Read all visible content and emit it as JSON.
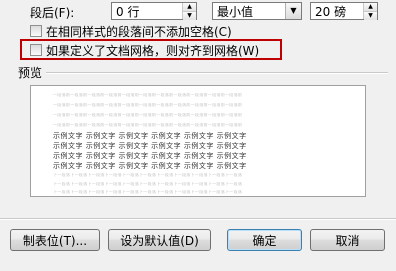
{
  "spacing": {
    "after_label": "段后(F):",
    "after_value": "0 行",
    "line_rule": "最小值",
    "line_at": "20 磅"
  },
  "options": {
    "no_space_same_style": "在相同样式的段落间不添加空格(C)",
    "snap_to_grid": "如果定义了文档网格，则对齐到网格(W)"
  },
  "preview": {
    "label": "预览",
    "prev_text": "一段落前一段落前一段落前一段落前一段落前一段落前一段落前一段落前一段落前一段落前一段落前",
    "sample_text": "示例文字 示例文字 示例文字 示例文字 示例文字 示例文字",
    "next_text": "下一段落下一段落下一段落下一段落下一段落下一段落下一段落下一段落下一段落下一段落下一段落"
  },
  "buttons": {
    "tabs": "制表位(T)...",
    "set_default": "设为默认值(D)",
    "ok": "确定",
    "cancel": "取消"
  },
  "colors": {
    "highlight_box": "#c00000",
    "dialog_bg": "#f0f0f0"
  }
}
